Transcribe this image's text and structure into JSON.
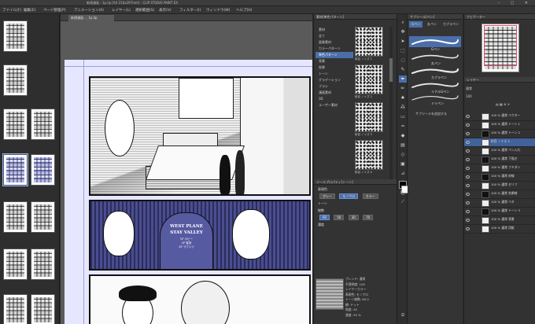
{
  "app": {
    "title": "新規漫画 - 1p.lip [A4 210x297mm] - CLIP STUDIO PAINT EX",
    "canvas_tab": "新規漫画 ... 1p.lip"
  },
  "menu": [
    "ファイル(F)",
    "編集(E)",
    "ページ管理(P)",
    "アニメーション(A)",
    "レイヤー(L)",
    "選択範囲(S)",
    "表示(V)",
    "フィルター(I)",
    "ウィンドウ(W)",
    "ヘルプ(H)"
  ],
  "subtool": {
    "header": "素材[単色パターン]",
    "tree": [
      "素材",
      "全て",
      "画像素材",
      "カラーパターン",
      "単色パターン",
      "背景",
      "効果",
      "トーン",
      "グラデーション",
      "ブラシ",
      "漫画素材",
      "3D",
      "ユーザー素材"
    ],
    "tree_selected": "単色パターン",
    "materials": [
      "砂目 ノイズ 1",
      "砂目 ノイズ 2",
      "砂目 ノイズ 3",
      "砂目 ノイズ 4"
    ],
    "prop_header": "ツールプロパティ[トーン]",
    "prop_rows": [
      "表現色",
      "トーン",
      "線数",
      "濃度"
    ],
    "prop_buttons": [
      "グレー",
      "モノクロ",
      "カラー"
    ],
    "prop_vals": [
      "60",
      "50",
      "30",
      "70"
    ],
    "layer_info": [
      "ブレンド: 通常",
      "不透明度: 100",
      "レイヤーカラー",
      "表現色: モノクロ",
      "トーン線数: 60.0",
      "網: ドット",
      "角度: 45",
      "濃度: 50 %"
    ]
  },
  "brush": {
    "tabs": [
      "Gペン",
      "丸ペン",
      "カブラペン"
    ],
    "items": [
      "Gペン",
      "丸ペン",
      "カブラペン",
      "リアルGペン",
      "ミリペン",
      "スクールペン"
    ],
    "selected": "Gペン",
    "add_label": "サブツールを追加する"
  },
  "layers": {
    "header": "レイヤー",
    "blend": "通常",
    "opacity": "100",
    "items": [
      "100 % 通常 ベクター",
      "100 % 通常 トーン 1",
      "100 % 通常 トーン 2",
      "砂目 ノイズ 3",
      "100 % 通常 ペン入れ",
      "100 % 通常 下描き",
      "100 % 通常 フキダシ",
      "100 % 通常 枠線",
      "100 % 通常 セリフ",
      "100 % 通常 効果線",
      "100 % 通常 ベタ",
      "100 % 通常 トーン 3",
      "100 % 通常 背景",
      "100 % 通常 用紙"
    ],
    "selected_index": 3
  },
  "comic": {
    "sign_line1": "WEST PLANE",
    "sign_line2": "STAY VALLEY",
    "sign_small": [
      "1F ロビー",
      "2F 客室",
      "3F ラウンジ"
    ]
  },
  "colors": {
    "accent": "#4a6ea9",
    "paper": "#e6e7ff",
    "sign_panel": "#3a3d78"
  }
}
